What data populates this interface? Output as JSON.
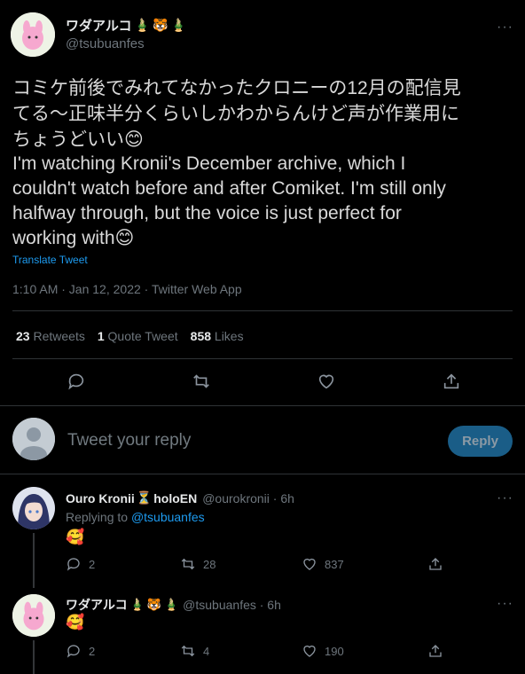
{
  "main_tweet": {
    "display_name": "ワダアルコ",
    "handle": "@tsubuanfes",
    "text_jp_line1": "コミケ前後でみれてなかったクロニーの12月の配信見",
    "text_jp_line2": "てる〜正味半分くらいしかわからんけど声が作業用に",
    "text_jp_line3": "ちょうどいい😊",
    "text_en_line1": "I'm watching Kronii's December archive, which I",
    "text_en_line2": "couldn't watch before and after Comiket. I'm still only",
    "text_en_line3": "halfway through, but the voice is just perfect for",
    "text_en_line4": "working with😊",
    "translate_label": "Translate Tweet",
    "timestamp": "1:10 AM · Jan 12, 2022 · Twitter Web App",
    "stats": {
      "retweets_count": "23",
      "retweets_label": "Retweets",
      "quote_count": "1",
      "quote_label": "Quote Tweet",
      "likes_count": "858",
      "likes_label": "Likes"
    }
  },
  "reply_box": {
    "placeholder": "Tweet your reply",
    "button_label": "Reply"
  },
  "replies": [
    {
      "display_name": "Ouro Kronii",
      "name_suffix": "holoEN",
      "handle_time": "@ourokronii · 6h",
      "replying_to_label": "Replying to",
      "replying_to_handle": "@tsubuanfes",
      "text": "🥰",
      "replies": "2",
      "retweets": "28",
      "likes": "837"
    },
    {
      "display_name": "ワダアルコ",
      "handle_time": "@tsubuanfes · 6h",
      "text": "🥰",
      "replies": "2",
      "retweets": "4",
      "likes": "190"
    }
  ],
  "more_label": "···",
  "colors": {
    "background": "#000000",
    "accent_blue": "#1d9bf0",
    "reply_button": "#1a5d87",
    "divider": "#2f3336",
    "secondary_text": "#6e767d"
  }
}
